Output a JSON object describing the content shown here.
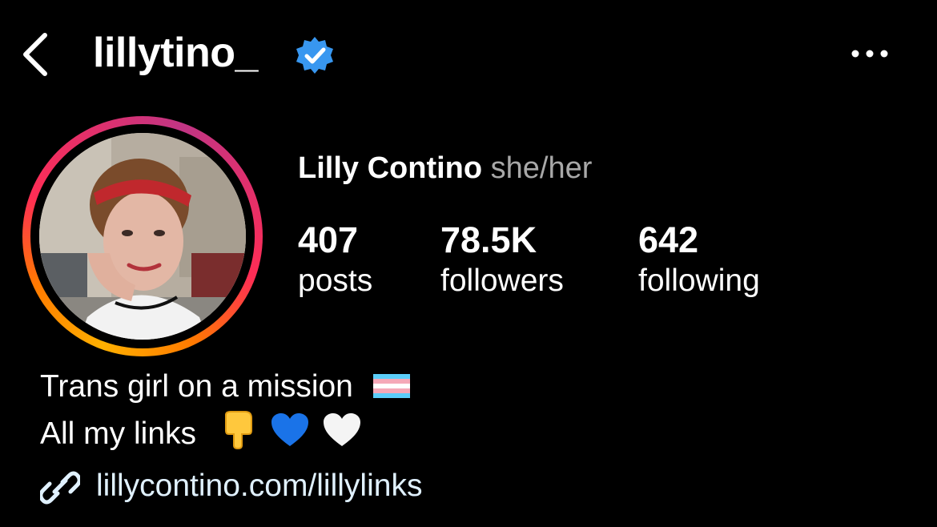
{
  "header": {
    "username": "lillytino_",
    "verified": true,
    "back_icon": "chevron-left-icon",
    "more_icon": "more-horizontal-icon"
  },
  "profile": {
    "full_name": "Lilly Contino",
    "pronouns": "she/her",
    "story_ring_colors": [
      "#ffb000",
      "#ff7a00",
      "#ff2d55",
      "#e1306c",
      "#c13584"
    ]
  },
  "stats": {
    "posts": {
      "value": "407",
      "label": "posts"
    },
    "followers": {
      "value": "78.5K",
      "label": "followers"
    },
    "following": {
      "value": "642",
      "label": "following"
    }
  },
  "bio": {
    "line1": "Trans girl on a mission",
    "line2": "All my links",
    "emojis": [
      "transgender-flag",
      "backhand-index-pointing-down",
      "blue-heart",
      "white-heart"
    ]
  },
  "link": {
    "icon": "link-icon",
    "text": "lillycontino.com/lillylinks"
  },
  "colors": {
    "background": "#000000",
    "text": "#ffffff",
    "muted": "#a8a8a8",
    "verified": "#3897f0",
    "link": "#e0f1ff"
  }
}
